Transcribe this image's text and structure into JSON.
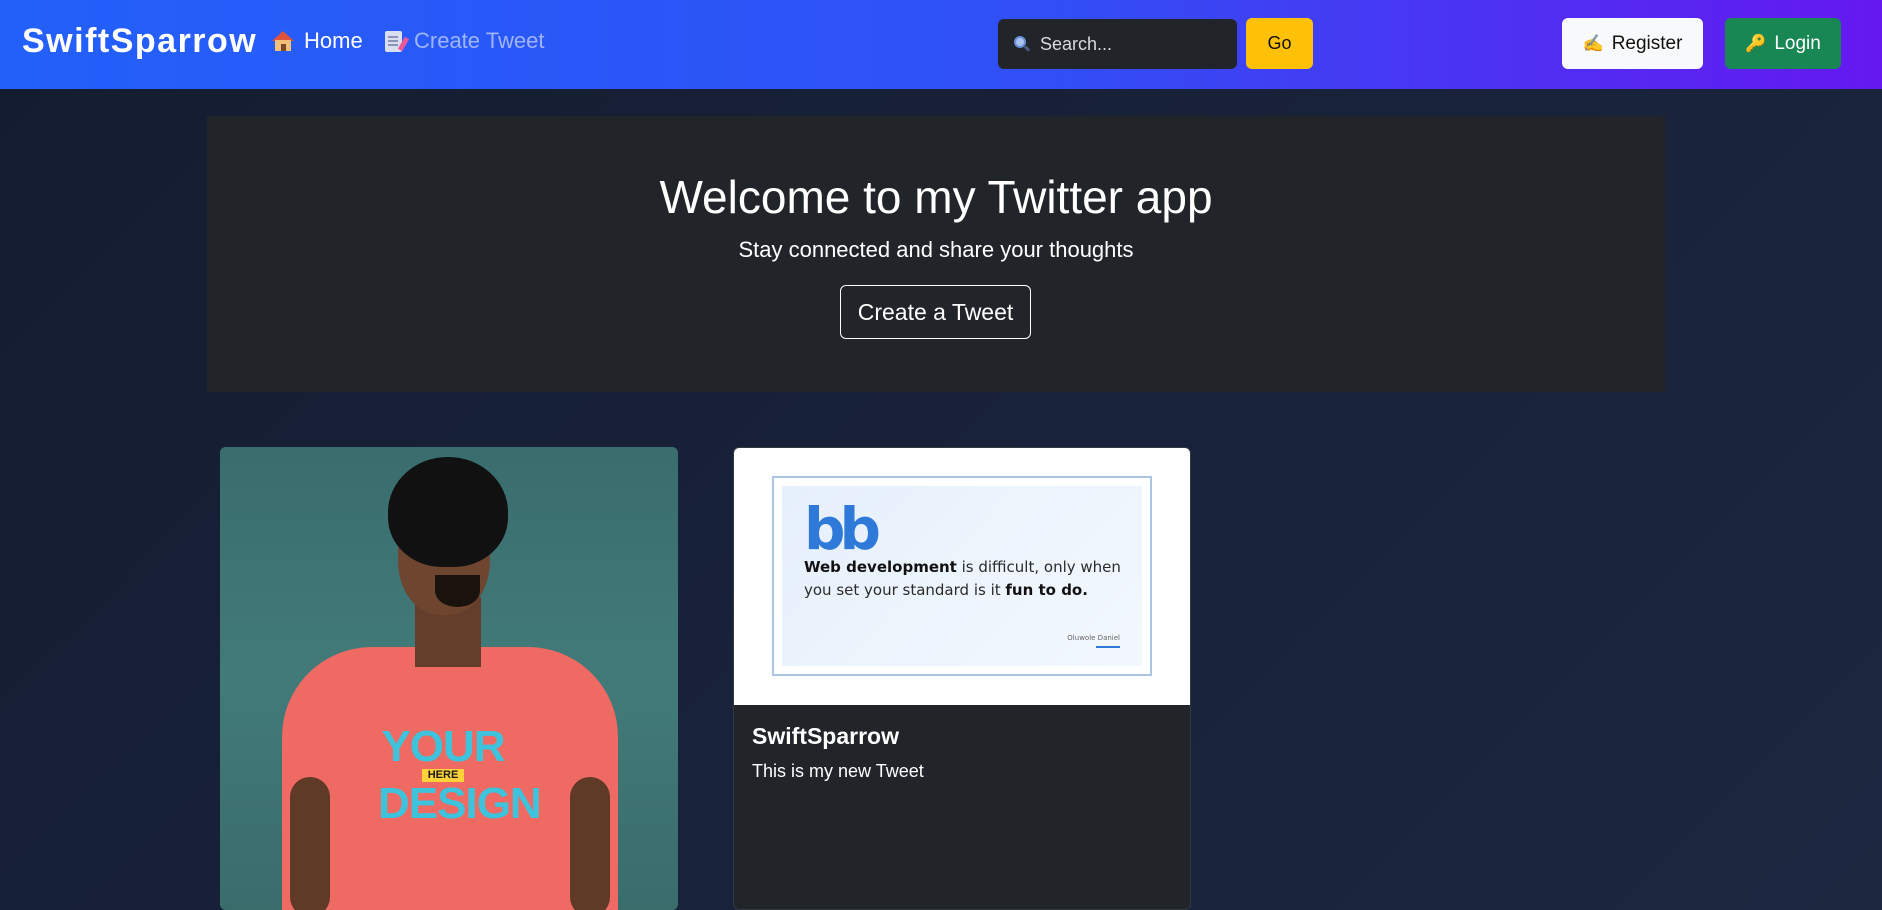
{
  "navbar": {
    "brand": "SwiftSparrow",
    "links": [
      {
        "label": "Home",
        "icon": "house-icon",
        "active": true
      },
      {
        "label": "Create Tweet",
        "icon": "memo-icon",
        "active": false
      }
    ],
    "search": {
      "placeholder": "Search...",
      "value": "",
      "icon": "search-icon"
    },
    "go_label": "Go",
    "register_label": "Register",
    "register_icon": "✍",
    "login_label": "Login",
    "login_icon": "🔑"
  },
  "hero": {
    "title": "Welcome to my Twitter app",
    "subtitle": "Stay connected and share your thoughts",
    "cta_label": "Create a Tweet"
  },
  "tweets": [
    {
      "image": "man in coral t-shirt photo",
      "shirt_text": {
        "top": "YOUR",
        "tag": "HERE",
        "bottom": "DESIGN"
      }
    },
    {
      "image": "quote graphic",
      "quote": {
        "mark": "bb",
        "bold1": "Web development",
        "middle": " is difficult, only when you set your standard is it ",
        "bold2": "fun to do.",
        "author": "Oluwole Daniel"
      },
      "title": "SwiftSparrow",
      "text": "This is my new Tweet"
    }
  ],
  "colors": {
    "nav_start": "#2360fa",
    "nav_end": "#6518f0",
    "go_button": "#ffc107",
    "login_button": "#198754",
    "hero_bg": "#212429"
  }
}
